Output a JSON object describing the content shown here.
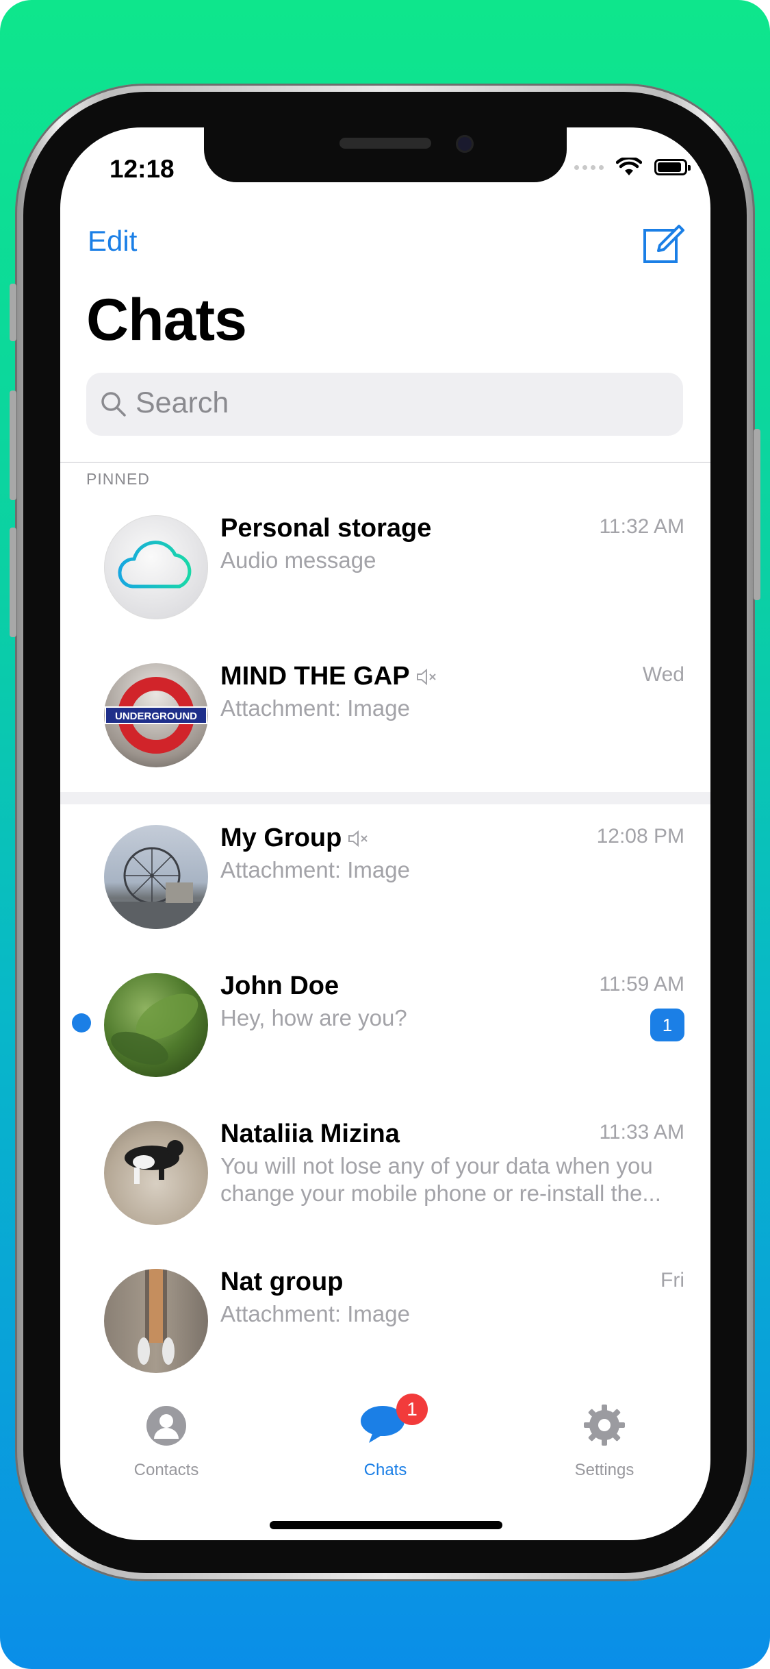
{
  "status_bar": {
    "time": "12:18"
  },
  "header": {
    "edit_label": "Edit",
    "title": "Chats"
  },
  "search": {
    "placeholder": "Search"
  },
  "pinned_label": "PINNED",
  "chats": [
    {
      "name": "Personal storage",
      "message": "Audio message",
      "time": "11:32 AM",
      "muted": false,
      "unread": 0,
      "avatar": "cloud-icon"
    },
    {
      "name": "MIND THE GAP",
      "message": "Attachment: Image",
      "time": "Wed",
      "muted": true,
      "unread": 0,
      "avatar": "underground-sign-photo"
    },
    {
      "name": "My Group",
      "message": "Attachment: Image",
      "time": "12:08 PM",
      "muted": true,
      "unread": 0,
      "avatar": "ferris-wheel-photo"
    },
    {
      "name": "John Doe",
      "message": "Hey, how are you?",
      "time": "11:59 AM",
      "muted": false,
      "unread": "1",
      "avatar": "leaf-photo"
    },
    {
      "name": "Nataliia Mizina",
      "message": "You will not lose any of your data when you change your mobile phone or re-install the...",
      "time": "11:33 AM",
      "muted": false,
      "unread": 0,
      "avatar": "cat-photo"
    },
    {
      "name": "Nat group",
      "message": "Attachment: Image",
      "time": "Fri",
      "muted": false,
      "unread": 0,
      "avatar": "feet-photo"
    }
  ],
  "tabbar": {
    "contacts_label": "Contacts",
    "chats_label": "Chats",
    "chats_badge": "1",
    "settings_label": "Settings"
  },
  "colors": {
    "accent": "#1b7fe6",
    "badge_red": "#f23b3b",
    "secondary_text": "#a3a3a8"
  }
}
